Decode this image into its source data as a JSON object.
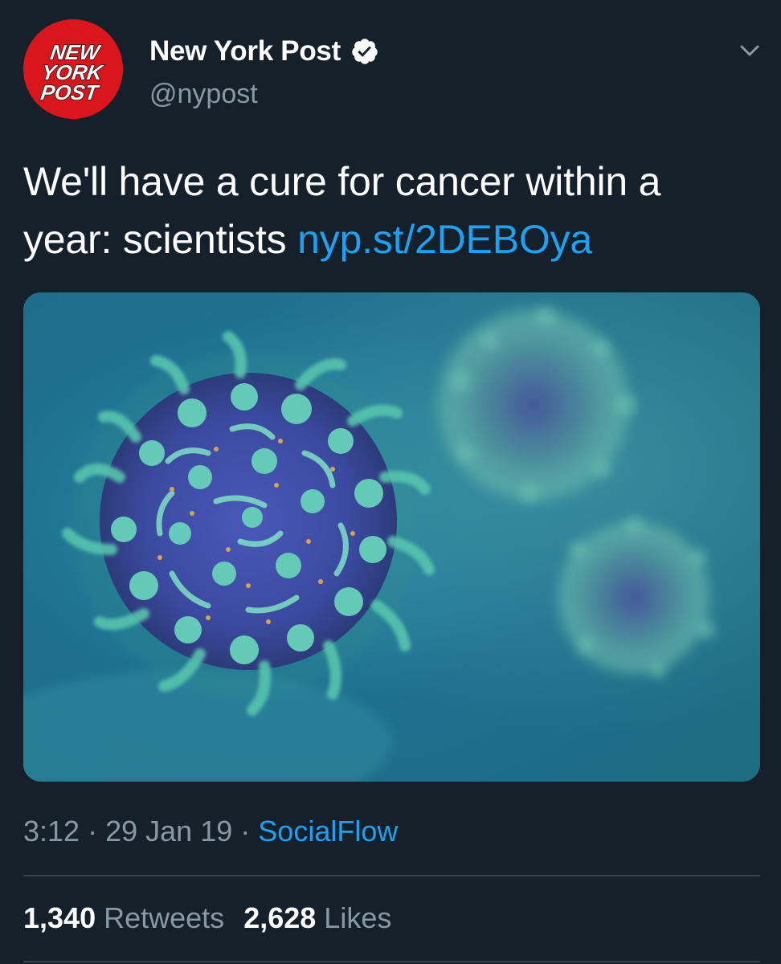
{
  "tweet": {
    "author": {
      "display_name": "New York Post",
      "handle": "@nypost",
      "verified": true,
      "avatar_logo": [
        "NEW",
        "YORK",
        "POST"
      ]
    },
    "text": "We'll have a cure for cancer within a year: scientists ",
    "link": "nyp.st/2DEBOya",
    "time": "3:12",
    "date": "29 Jan 19",
    "separator": "·",
    "source": "SocialFlow",
    "retweets_count": "1,340",
    "retweets_label": "Retweets",
    "likes_count": "2,628",
    "likes_label": "Likes"
  },
  "icons": {
    "verified": "verified-badge-icon",
    "menu": "chevron-down-icon"
  },
  "colors": {
    "background": "#15202b",
    "link": "#1da1f2",
    "secondary_text": "#8899a6",
    "avatar_red": "#d8161b"
  }
}
